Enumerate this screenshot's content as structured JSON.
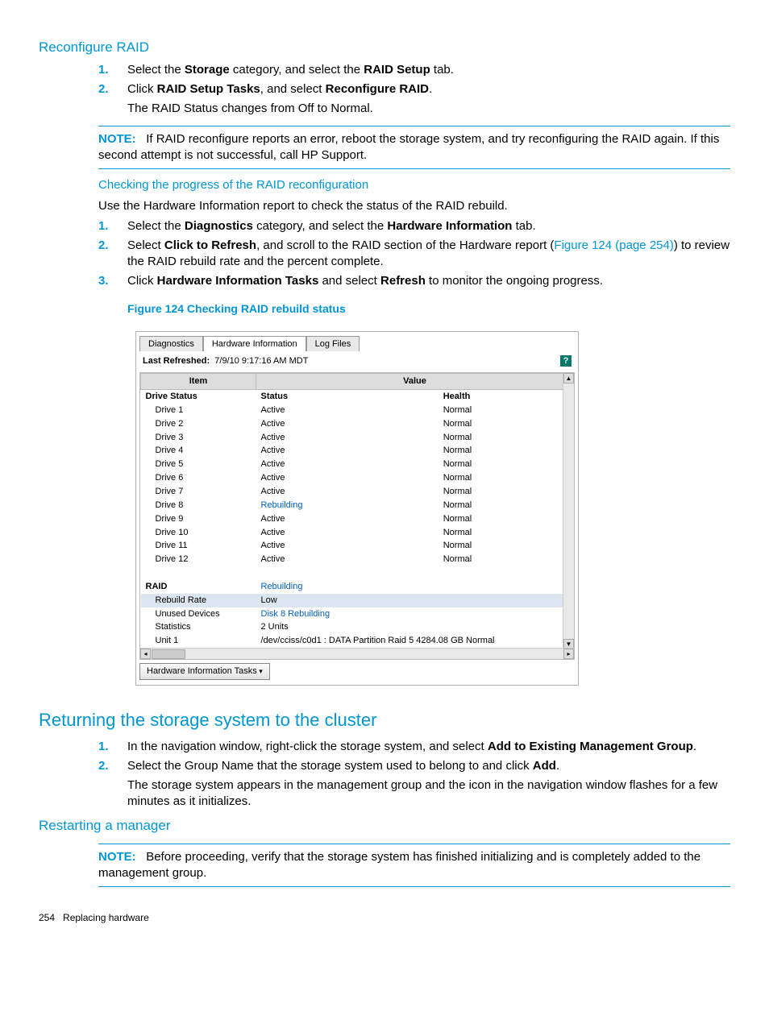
{
  "sec1": {
    "title": "Reconfigure RAID",
    "steps": [
      {
        "pre": "Select the ",
        "b1": "Storage",
        "mid": " category, and select the ",
        "b2": "RAID Setup",
        "post": " tab."
      },
      {
        "pre": "Click ",
        "b1": "RAID Setup Tasks",
        "mid": ", and select ",
        "b2": "Reconfigure RAID",
        "post": ".",
        "extra": "The RAID Status changes from Off to Normal."
      }
    ],
    "note": {
      "label": "NOTE:",
      "text": "If RAID reconfigure reports an error, reboot the storage system, and try reconfiguring the RAID again. If this second attempt is not successful, call HP Support."
    }
  },
  "sec1b": {
    "title": "Checking the progress of the RAID reconfiguration",
    "intro": "Use the Hardware Information report to check the status of the RAID rebuild.",
    "steps": [
      {
        "pre": "Select the ",
        "b1": "Diagnostics",
        "mid": " category, and select the ",
        "b2": "Hardware Information",
        "post": " tab."
      },
      {
        "pre": "Select ",
        "b1": "Click to Refresh",
        "mid": ", and scroll to the RAID section of the Hardware report (",
        "link": "Figure 124 (page 254)",
        "post2": ") to review the RAID rebuild rate and the percent complete."
      },
      {
        "pre": "Click ",
        "b1": "Hardware Information Tasks",
        "mid": " and select ",
        "b2": "Refresh",
        "post": " to monitor the ongoing progress."
      }
    ],
    "figcap": "Figure 124 Checking RAID rebuild status"
  },
  "shot": {
    "tabs": [
      "Diagnostics",
      "Hardware Information",
      "Log Files"
    ],
    "refreshed_label": "Last Refreshed:",
    "refreshed_value": "7/9/10 9:17:16 AM MDT",
    "help": "?",
    "col_item": "Item",
    "col_value": "Value",
    "drive_status_hdr": {
      "c1": "Drive Status",
      "c2": "Status",
      "c3": "Health"
    },
    "drives": [
      {
        "name": "Drive 1",
        "status": "Active",
        "health": "Normal"
      },
      {
        "name": "Drive 2",
        "status": "Active",
        "health": "Normal"
      },
      {
        "name": "Drive 3",
        "status": "Active",
        "health": "Normal"
      },
      {
        "name": "Drive 4",
        "status": "Active",
        "health": "Normal"
      },
      {
        "name": "Drive 5",
        "status": "Active",
        "health": "Normal"
      },
      {
        "name": "Drive 6",
        "status": "Active",
        "health": "Normal"
      },
      {
        "name": "Drive 7",
        "status": "Active",
        "health": "Normal"
      },
      {
        "name": "Drive 8",
        "status": "Rebuilding",
        "health": "Normal",
        "blue": true
      },
      {
        "name": "Drive 9",
        "status": "Active",
        "health": "Normal"
      },
      {
        "name": "Drive 10",
        "status": "Active",
        "health": "Normal"
      },
      {
        "name": "Drive 11",
        "status": "Active",
        "health": "Normal"
      },
      {
        "name": "Drive 12",
        "status": "Active",
        "health": "Normal"
      }
    ],
    "raid_rows": [
      {
        "name": "RAID",
        "val": "Rebuilding",
        "blue": true,
        "bold": true
      },
      {
        "name": "Rebuild Rate",
        "val": "Low",
        "sel": true
      },
      {
        "name": "Unused Devices",
        "val": "Disk 8 Rebuilding",
        "blue": true
      },
      {
        "name": "Statistics",
        "val": "2 Units"
      },
      {
        "name": "Unit 1",
        "val": "/dev/cciss/c0d1 : DATA Partition Raid 5 4284.08 GB Normal"
      }
    ],
    "tasks_btn": "Hardware Information Tasks"
  },
  "sec2": {
    "title": "Returning the storage system to the cluster",
    "steps": [
      {
        "pre": "In the navigation window, right-click the storage system, and select ",
        "b1": "Add to Existing Management Group",
        "post": "."
      },
      {
        "pre": "Select the Group Name that the storage system used to belong to and click ",
        "b1": "Add",
        "post": ".",
        "extra": "The storage system appears in the management group and the icon in the navigation window flashes for a few minutes as it initializes."
      }
    ]
  },
  "sec3": {
    "title": "Restarting a manager",
    "note": {
      "label": "NOTE:",
      "text": "Before proceeding, verify that the storage system has finished initializing and is completely added to the management group."
    }
  },
  "footer": {
    "page": "254",
    "chapter": "Replacing hardware"
  }
}
